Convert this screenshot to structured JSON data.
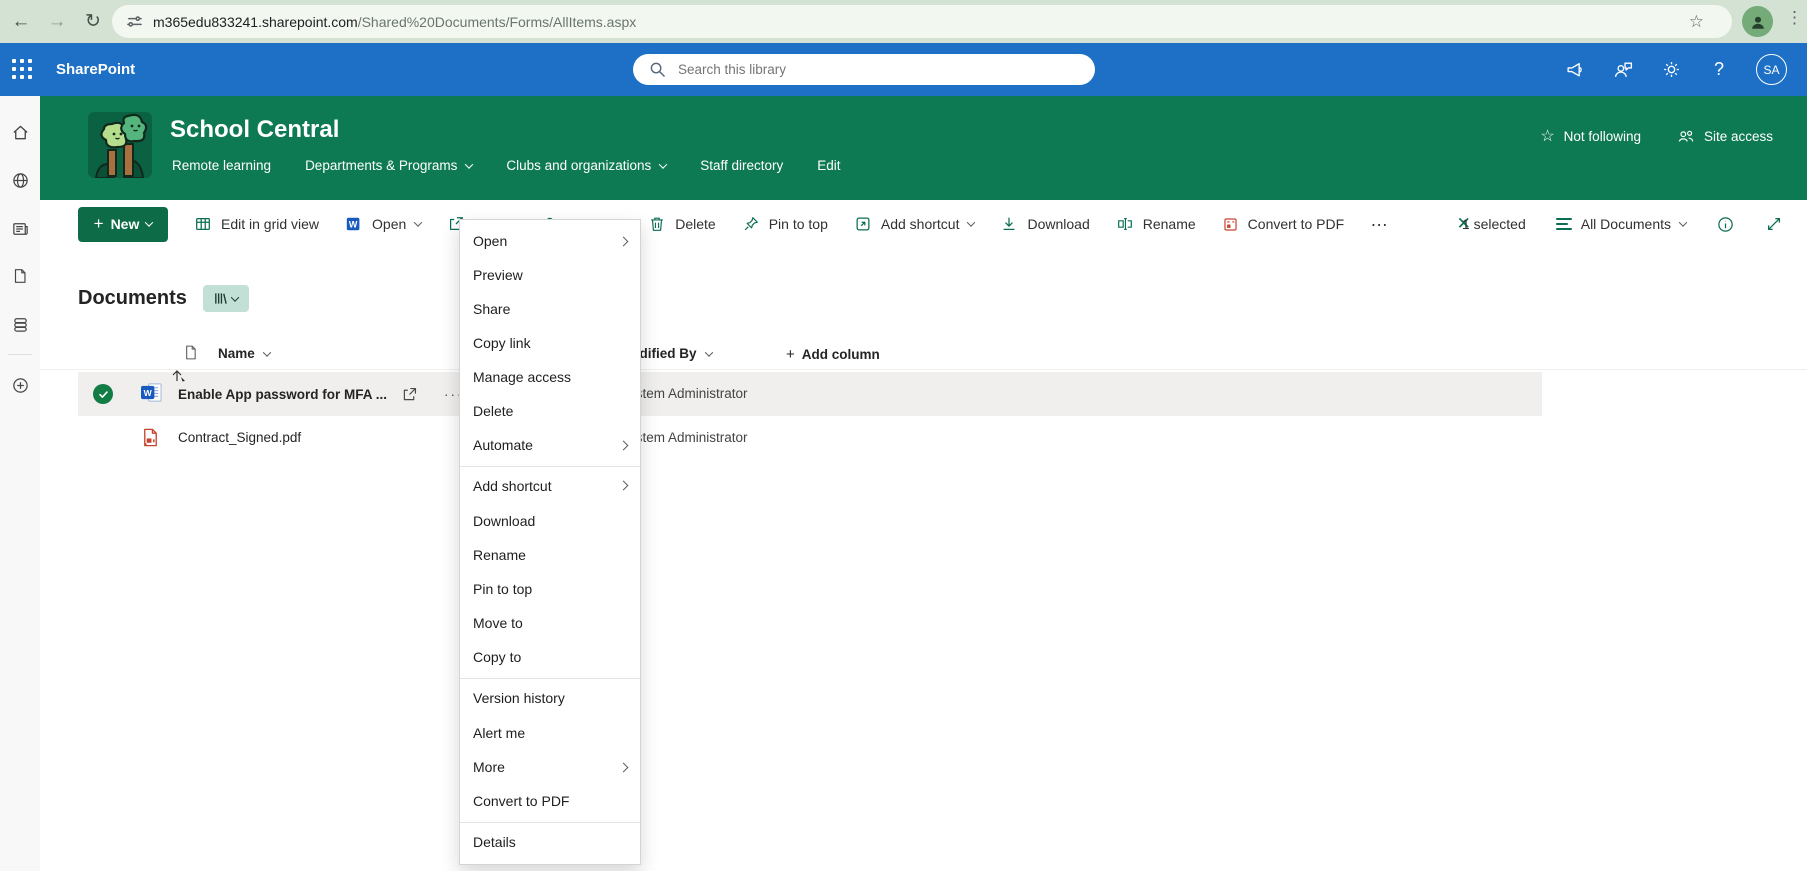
{
  "colors": {
    "suite_blue": "#1d70c6",
    "header_green": "#0e7a53",
    "button_green": "#0d6b47",
    "toolbar_icon_teal": "#0b6e54",
    "selected_row_bg": "#f0efed",
    "word_blue": "#185abd",
    "pdf_red": "#c8432e",
    "check_green": "#127c45"
  },
  "browser": {
    "url_host": "m365edu833241.sharepoint.com",
    "url_path": "/Shared%20Documents/Forms/AllItems.aspx"
  },
  "suite_bar": {
    "app_name": "SharePoint",
    "search_placeholder": "Search this library",
    "avatar_initials": "SA"
  },
  "site_header": {
    "title": "School Central",
    "nav": [
      {
        "label": "Remote learning",
        "chevron": false
      },
      {
        "label": "Departments & Programs",
        "chevron": true
      },
      {
        "label": "Clubs and organizations",
        "chevron": true
      },
      {
        "label": "Staff directory",
        "chevron": false
      },
      {
        "label": "Edit",
        "chevron": false
      }
    ],
    "follow_label": "Not following",
    "access_label": "Site access"
  },
  "toolbar": {
    "new_label": "New",
    "edit_grid_label": "Edit in grid view",
    "open_label": "Open",
    "share_label": "Share",
    "copy_link_label": "Copy link",
    "delete_label": "Delete",
    "pin_label": "Pin to top",
    "add_shortcut_label": "Add shortcut",
    "download_label": "Download",
    "rename_label": "Rename",
    "convert_pdf_label": "Convert to PDF",
    "selected_count": "1 selected",
    "view_name": "All Documents"
  },
  "library": {
    "title": "Documents",
    "columns": {
      "name": "Name",
      "modified_by": "Modified By",
      "add_column": "Add column"
    },
    "rows": [
      {
        "name": "Enable App password for MFA ...",
        "modified_by": "System Administrator"
      },
      {
        "name": "Contract_Signed.pdf",
        "modified_by": "System Administrator"
      }
    ]
  },
  "context_menu": {
    "items": [
      {
        "label": "Open",
        "submenu": true
      },
      {
        "label": "Preview",
        "submenu": false
      },
      {
        "label": "Share",
        "submenu": false
      },
      {
        "label": "Copy link",
        "submenu": false
      },
      {
        "label": "Manage access",
        "submenu": false
      },
      {
        "label": "Delete",
        "submenu": false
      },
      {
        "label": "Automate",
        "submenu": true
      },
      {
        "label": "Add shortcut",
        "submenu": true
      },
      {
        "label": "Download",
        "submenu": false
      },
      {
        "label": "Rename",
        "submenu": false
      },
      {
        "label": "Pin to top",
        "submenu": false
      },
      {
        "label": "Move to",
        "submenu": false
      },
      {
        "label": "Copy to",
        "submenu": false
      },
      {
        "label": "Version history",
        "submenu": false
      },
      {
        "label": "Alert me",
        "submenu": false
      },
      {
        "label": "More",
        "submenu": true
      },
      {
        "label": "Convert to PDF",
        "submenu": false
      },
      {
        "label": "Details",
        "submenu": false
      }
    ]
  }
}
